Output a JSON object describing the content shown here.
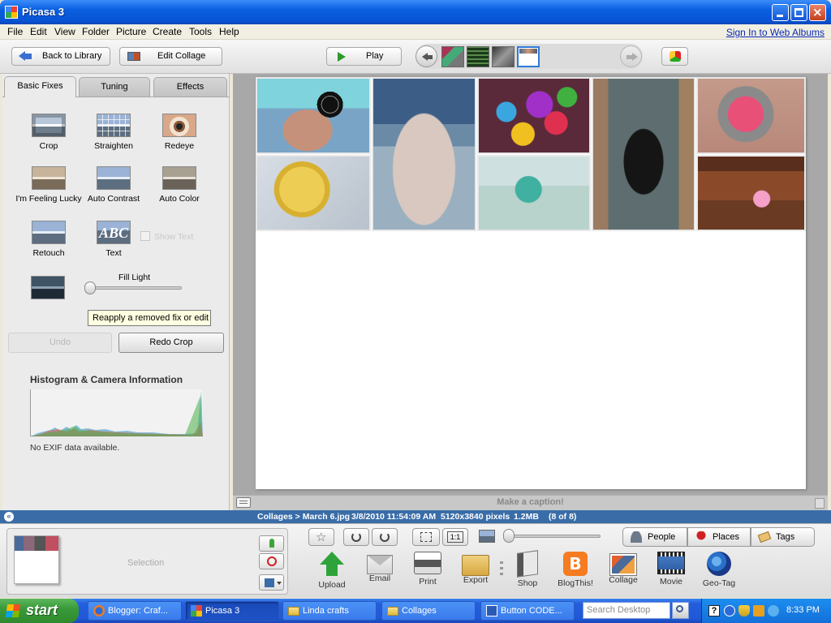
{
  "window": {
    "title": "Picasa 3",
    "controls": [
      "minimize",
      "maximize",
      "close"
    ]
  },
  "menu": {
    "items": [
      "File",
      "Edit",
      "View",
      "Folder",
      "Picture",
      "Create",
      "Tools",
      "Help"
    ],
    "signin": "Sign In to Web Albums"
  },
  "toolbar": {
    "back_label": "Back to Library",
    "edit_collage_label": "Edit Collage",
    "play_label": "Play"
  },
  "tabs": {
    "basic": "Basic Fixes",
    "tuning": "Tuning",
    "effects": "Effects"
  },
  "tools": {
    "crop": "Crop",
    "straighten": "Straighten",
    "redeye": "Redeye",
    "lucky": "I'm Feeling Lucky",
    "autocontrast": "Auto Contrast",
    "autocolor": "Auto Color",
    "retouch": "Retouch",
    "text": "Text",
    "text_thumb": "ABC",
    "show_text": "Show Text",
    "fill_light": "Fill Light",
    "fill_light_value": 0
  },
  "tooltip": "Reapply a removed fix or edit",
  "undo_label": "Undo",
  "redo_label": "Redo Crop",
  "histogram": {
    "title": "Histogram & Camera Information",
    "exif": "No EXIF data available."
  },
  "caption": "Make a caption!",
  "status": {
    "path": "Collages > March 6.jpg",
    "datetime": "3/8/2010 11:54:09 AM",
    "dimensions": "5120x3840 pixels",
    "size": "1.2MB",
    "position": "(8 of 8)"
  },
  "tray": {
    "selection_label": "Selection",
    "oneone": "1:1",
    "people": "People",
    "places": "Places",
    "tags": "Tags",
    "actions": {
      "upload": "Upload",
      "email": "Email",
      "print": "Print",
      "export": "Export",
      "shop": "Shop",
      "blog": "BlogThis!",
      "collage": "Collage",
      "movie": "Movie",
      "geotag": "Geo-Tag"
    },
    "blog_glyph": "B"
  },
  "taskbar": {
    "start": "start",
    "tasks": [
      "Blogger: Craf...",
      "Picasa 3",
      "Linda crafts",
      "Collages",
      "Button CODE..."
    ],
    "search_placeholder": "Search Desktop",
    "clock": "8:33 PM",
    "help_glyph": "?"
  },
  "colors": {
    "title_bar": "#0a5fe0",
    "status_bar": "#3a6da8",
    "taskbar": "#245edc",
    "start_button": "#3a9a3a"
  }
}
